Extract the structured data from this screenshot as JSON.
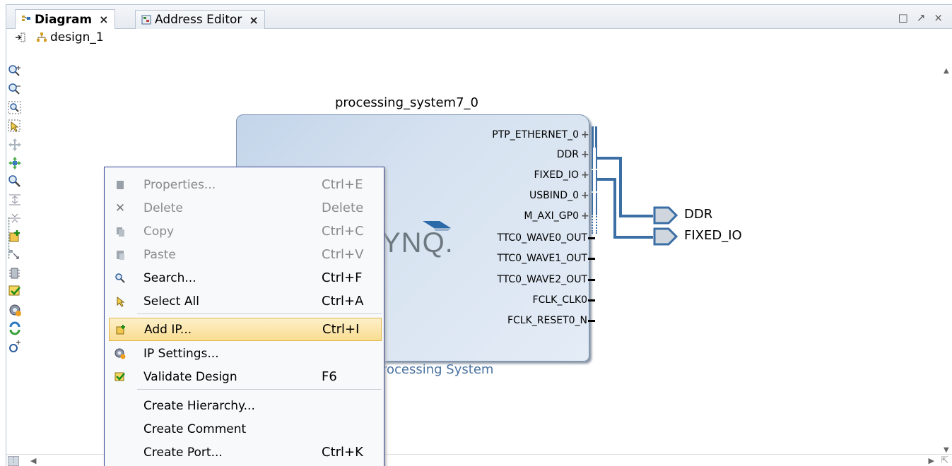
{
  "tabs": [
    {
      "label": "Diagram",
      "active": true,
      "icon": "diagram-icon"
    },
    {
      "label": "Address Editor",
      "active": false,
      "icon": "address-editor-icon"
    }
  ],
  "close_glyph": "×",
  "window_controls": [
    "□",
    "↗",
    "×"
  ],
  "design": {
    "name": "design_1"
  },
  "left_tools": [
    "zoom-in-icon",
    "zoom-out-icon",
    "zoom-area-icon",
    "select-area-icon",
    "move-icon",
    "fit-icon",
    "search-icon",
    "collapse-icon",
    "expand-icon",
    "add-ip-icon",
    "route-icon",
    "hierarchy-icon",
    "validate-icon",
    "settings-icon",
    "regenerate-icon",
    "refresh-icon"
  ],
  "ip": {
    "instance_name": "processing_system7_0",
    "logo_text": "YNQ.",
    "footer": "rocessing System",
    "ports": [
      {
        "name": "PTP_ETHERNET_0",
        "type": "interface"
      },
      {
        "name": "DDR",
        "type": "interface"
      },
      {
        "name": "FIXED_IO",
        "type": "interface"
      },
      {
        "name": "USBIND_0",
        "type": "interface"
      },
      {
        "name": "M_AXI_GP0",
        "type": "interface"
      },
      {
        "name": "TTC0_WAVE0_OUT",
        "type": "pin"
      },
      {
        "name": "TTC0_WAVE1_OUT",
        "type": "pin"
      },
      {
        "name": "TTC0_WAVE2_OUT",
        "type": "pin"
      },
      {
        "name": "FCLK_CLK0",
        "type": "pin"
      },
      {
        "name": "FCLK_RESET0_N",
        "type": "pin"
      }
    ]
  },
  "external_ports": [
    "DDR",
    "FIXED_IO"
  ],
  "context_menu": [
    {
      "label": "Properties...",
      "shortcut": "Ctrl+E",
      "enabled": false,
      "icon": "properties-icon"
    },
    {
      "label": "Delete",
      "shortcut": "Delete",
      "enabled": false,
      "icon": "delete-icon"
    },
    {
      "label": "Copy",
      "shortcut": "Ctrl+C",
      "enabled": false,
      "icon": "copy-icon"
    },
    {
      "label": "Paste",
      "shortcut": "Ctrl+V",
      "enabled": false,
      "icon": "paste-icon"
    },
    {
      "label": "Search...",
      "shortcut": "Ctrl+F",
      "enabled": true,
      "icon": "search-icon"
    },
    {
      "label": "Select All",
      "shortcut": "Ctrl+A",
      "enabled": true,
      "icon": "select-all-icon"
    },
    {
      "label": "Add IP...",
      "shortcut": "Ctrl+I",
      "enabled": true,
      "icon": "add-ip-icon",
      "highlighted": true
    },
    {
      "label": "IP Settings...",
      "shortcut": "",
      "enabled": true,
      "icon": "ip-settings-icon"
    },
    {
      "label": "Validate Design",
      "shortcut": "F6",
      "enabled": true,
      "icon": "validate-icon"
    },
    {
      "label": "Create Hierarchy...",
      "shortcut": "",
      "enabled": true,
      "icon": ""
    },
    {
      "label": "Create Comment",
      "shortcut": "",
      "enabled": true,
      "icon": ""
    },
    {
      "label": "Create Port...",
      "shortcut": "Ctrl+K",
      "enabled": true,
      "icon": ""
    }
  ],
  "colors": {
    "accent": "#2f5f8f",
    "menu_border": "#374b9a",
    "highlight": "#f9dd91"
  }
}
